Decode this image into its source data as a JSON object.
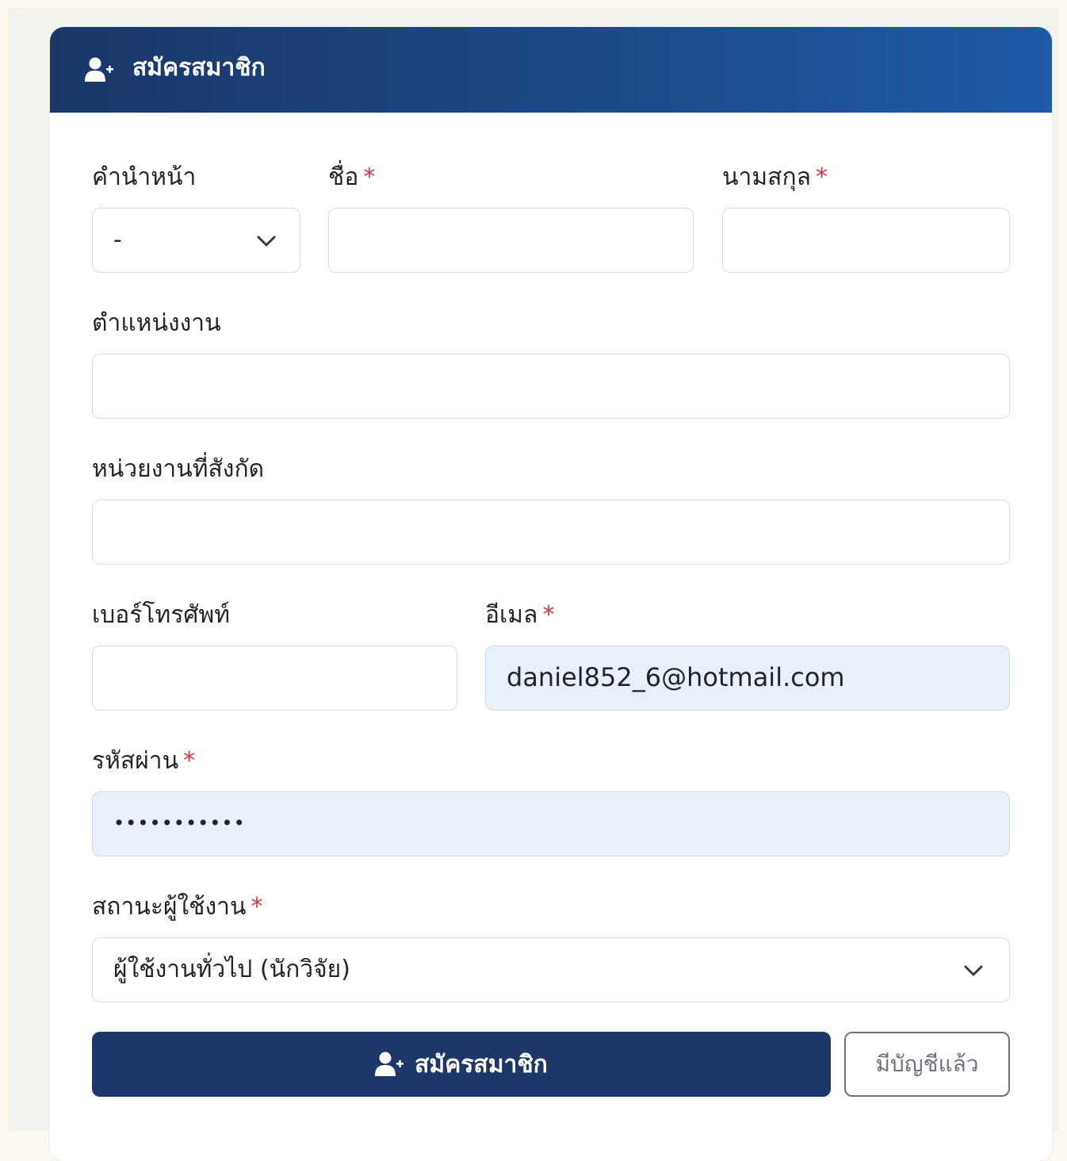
{
  "header": {
    "title": "สมัครสมาชิก",
    "icon": "user-plus-icon"
  },
  "form": {
    "prefix": {
      "label": "คำนำหน้า",
      "value": "-"
    },
    "first_name": {
      "label": "ชื่อ",
      "required": "*",
      "value": ""
    },
    "last_name": {
      "label": "นามสกุล",
      "required": "*",
      "value": ""
    },
    "position": {
      "label": "ตำแหน่งงาน",
      "value": ""
    },
    "organization": {
      "label": "หน่วยงานที่สังกัด",
      "value": ""
    },
    "phone": {
      "label": "เบอร์โทรศัพท์",
      "value": ""
    },
    "email": {
      "label": "อีเมล",
      "required": "*",
      "value": "daniel852_6@hotmail.com"
    },
    "password": {
      "label": "รหัสผ่าน",
      "required": "*",
      "value": "•••••••••••"
    },
    "user_status": {
      "label": "สถานะผู้ใช้งาน",
      "required": "*",
      "value": "ผู้ใช้งานทั่วไป (นักวิจัย)"
    }
  },
  "actions": {
    "register_label": "สมัครสมาชิก",
    "register_icon": "user-plus-icon",
    "have_account_label": "มีบัญชีแล้ว"
  },
  "colors": {
    "header_start": "#1a3768",
    "header_end": "#1f5ba8",
    "primary_button": "#1c3768",
    "required_mark": "#dc3545",
    "autofill_bg": "#e8f0fb"
  }
}
